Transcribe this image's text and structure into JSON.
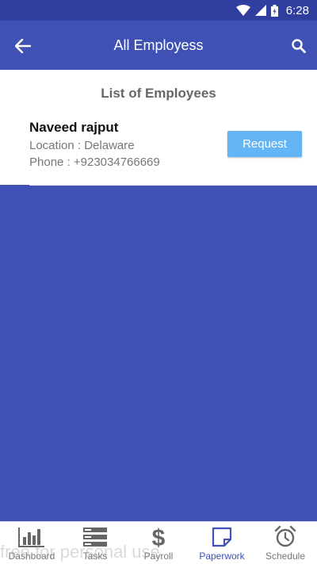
{
  "status_bar": {
    "time": "6:28"
  },
  "app_bar": {
    "title": "All Employess"
  },
  "list": {
    "title": "List of Employees",
    "employees": [
      {
        "name": "Naveed rajput",
        "location": "Location : Delaware",
        "phone": "Phone : +923034766669",
        "action": "Request"
      }
    ]
  },
  "bottom_nav": {
    "items": [
      {
        "label": "Dashboard",
        "icon": "bar-chart-icon"
      },
      {
        "label": "Tasks",
        "icon": "tasks-icon"
      },
      {
        "label": "Payroll",
        "icon": "dollar-icon"
      },
      {
        "label": "Paperwork",
        "icon": "note-icon",
        "active": true
      },
      {
        "label": "Schedule",
        "icon": "alarm-clock-icon"
      }
    ]
  },
  "watermark": "free for personal use",
  "colors": {
    "primary": "#3f51b5",
    "status_bar": "#303f9f",
    "button": "#64b5f6"
  }
}
